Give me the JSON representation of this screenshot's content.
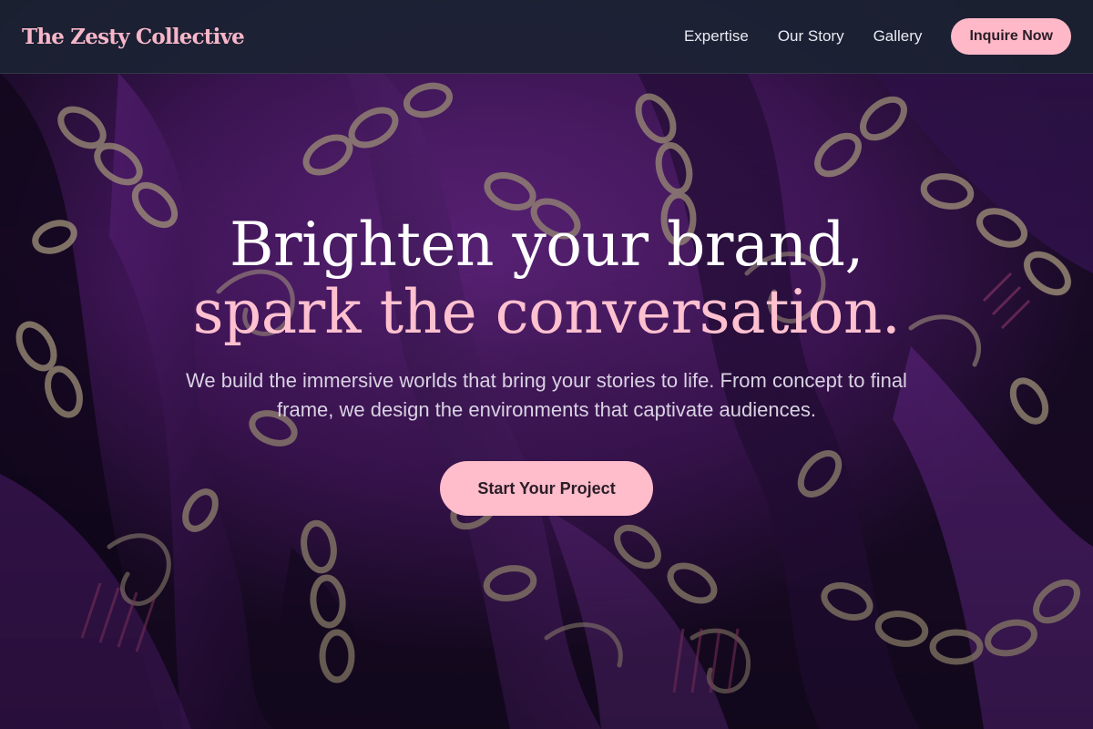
{
  "nav": {
    "brand": "The Zesty Collective",
    "links": [
      "Expertise",
      "Our Story",
      "Gallery"
    ],
    "cta": "Inquire Now"
  },
  "hero": {
    "headline_line1": "Brighten your brand,",
    "headline_line2": "spark the conversation.",
    "subtext": "We build the immersive worlds that bring your stories to life. From concept to final frame, we design the environments that captivate audiences.",
    "cta": "Start Your Project",
    "background_image": "purple silk scarf with gold chain print"
  },
  "colors": {
    "nav_bg": "#1c2234",
    "accent_pink": "#ffb8c8",
    "headline_white": "#ffffff",
    "headline_pink": "#ffc0cf",
    "silk_purple": "#5a1f78"
  }
}
